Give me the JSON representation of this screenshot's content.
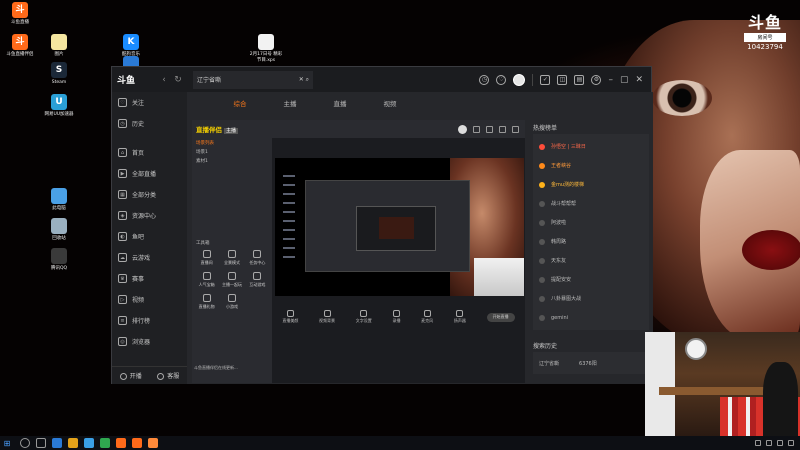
{
  "desktop": {
    "icons": [
      {
        "label": "斗鱼直播",
        "color": "#ff6a1a",
        "glyph": "斗"
      },
      {
        "label": "斗鱼直播伴侣",
        "color": "#ff6a1a",
        "glyph": "斗"
      },
      {
        "label": "图片",
        "color": "#f5e6a0",
        "glyph": ""
      },
      {
        "label": "酷狗音乐",
        "color": "#1a8cff",
        "glyph": "K"
      },
      {
        "label": "",
        "color": "#2a7ad6",
        "glyph": ""
      },
      {
        "label": "2月17日号 精彩节目.xps",
        "color": "#f2f2f2",
        "glyph": ""
      },
      {
        "label": "Steam",
        "color": "#1b2838",
        "glyph": "S"
      },
      {
        "label": "网易UU加速器",
        "color": "#2a9fd6",
        "glyph": "U"
      },
      {
        "label": "此电脑",
        "color": "#4aa0e6",
        "glyph": ""
      },
      {
        "label": "回收站",
        "color": "#9ab0c0",
        "glyph": ""
      },
      {
        "label": "腾讯QQ",
        "color": "#3a3a3a",
        "glyph": ""
      }
    ]
  },
  "watermark": {
    "logo": "斗鱼",
    "tag": "房间号",
    "room": "10423794"
  },
  "window": {
    "logo": "斗鱼",
    "tab_title": "辽宁省嘶"
  },
  "sidebar": {
    "items": [
      {
        "label": "关注",
        "icon": "heart-icon",
        "glyph": "♡"
      },
      {
        "label": "历史",
        "icon": "history-icon",
        "glyph": "◷"
      },
      {
        "label": "首页",
        "icon": "home-icon",
        "glyph": "⌂"
      },
      {
        "label": "全部直播",
        "icon": "live-icon",
        "glyph": "▶"
      },
      {
        "label": "全部分类",
        "icon": "category-icon",
        "glyph": "▦"
      },
      {
        "label": "资源中心",
        "icon": "resource-icon",
        "glyph": "◈"
      },
      {
        "label": "鱼吧",
        "icon": "fish-icon",
        "glyph": "◐"
      },
      {
        "label": "云游戏",
        "icon": "cloud-game-icon",
        "glyph": "☁"
      },
      {
        "label": "赛事",
        "icon": "trophy-icon",
        "glyph": "♛"
      },
      {
        "label": "视频",
        "icon": "video-icon",
        "glyph": "▷"
      },
      {
        "label": "排行榜",
        "icon": "rank-icon",
        "glyph": "≡"
      },
      {
        "label": "浏览器",
        "icon": "browser-icon",
        "glyph": "◎"
      }
    ],
    "bottom": {
      "start": "开播",
      "share": "客服"
    }
  },
  "main": {
    "tabs": [
      {
        "label": "综合",
        "active": true
      },
      {
        "label": "主播",
        "active": false
      },
      {
        "label": "直播",
        "active": false
      },
      {
        "label": "视频",
        "active": false
      }
    ]
  },
  "companion": {
    "logo": "直播伴侣",
    "badge": "主播",
    "left_rows": [
      "场景列表",
      "场景1",
      "素材1"
    ],
    "tools_label": "工具箱",
    "tools": [
      "直播间",
      "全景模式",
      "任务中心",
      "人气宝箱",
      "主播一起玩",
      "互动游戏",
      "直播礼物",
      "小游戏"
    ],
    "toolbar": [
      "直播美颜",
      "视频背景",
      "文字设置",
      "录播",
      "麦克风",
      "扬声器"
    ],
    "start_label": "开始直播",
    "footer": "斗鱼直播伴侣在线更新..."
  },
  "hot": {
    "title": "热搜榜单",
    "items": [
      {
        "rank": 1,
        "text": "孙悟空 | 三昧日"
      },
      {
        "rank": 2,
        "text": "王者峡谷"
      },
      {
        "rank": 3,
        "text": "金mu测的楼梯"
      },
      {
        "rank": 4,
        "text": "战斗帮帮帮"
      },
      {
        "rank": 5,
        "text": "阿波啦"
      },
      {
        "rank": 6,
        "text": "韩周路"
      },
      {
        "rank": 7,
        "text": "天东友"
      },
      {
        "rank": 8,
        "text": "提配安安"
      },
      {
        "rank": 9,
        "text": "八卦暴图大战"
      },
      {
        "rank": 10,
        "text": "gemini"
      }
    ],
    "history_title": "搜索历史",
    "history": [
      {
        "text": "辽宁省嘶"
      },
      {
        "text": "6376阳"
      }
    ]
  }
}
